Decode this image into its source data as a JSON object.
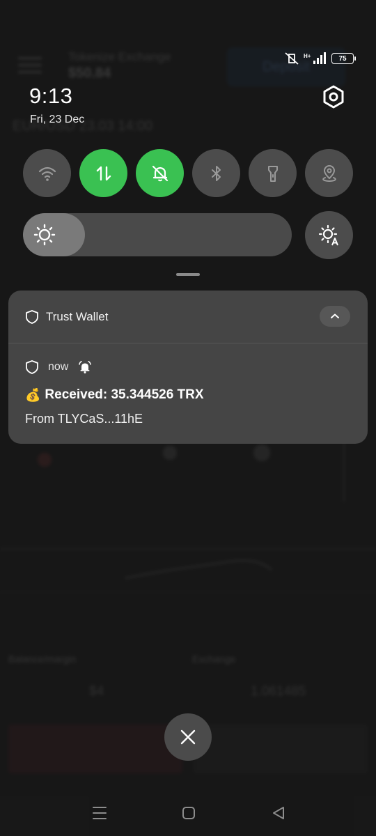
{
  "background_app": {
    "name": "Tokenize Exchange",
    "balance": "$50.84",
    "deposit_label": "Deposit",
    "pair": "EUR/USD 23.03 14:00",
    "label_a": "Balance/margin",
    "label_b": "Exchange",
    "row_left": "$4",
    "row_right": "1.061485"
  },
  "status_bar": {
    "battery": "75",
    "network": "H+"
  },
  "header": {
    "time": "9:13",
    "date": "Fri, 23 Dec"
  },
  "quick_settings": {
    "tiles": [
      {
        "name": "wifi",
        "icon": "wifi-icon",
        "active": false
      },
      {
        "name": "mobile-data",
        "icon": "mobile-data-icon",
        "active": true
      },
      {
        "name": "do-not-disturb",
        "icon": "bell-off-icon",
        "active": true
      },
      {
        "name": "bluetooth",
        "icon": "bluetooth-icon",
        "active": false
      },
      {
        "name": "flashlight",
        "icon": "flashlight-icon",
        "active": false
      },
      {
        "name": "location",
        "icon": "location-icon",
        "active": false
      }
    ],
    "brightness_level": 0.23,
    "auto_brightness_icon": "auto-brightness-icon"
  },
  "notification": {
    "app_name": "Trust Wallet",
    "time_label": "now",
    "title_emoji": "💰",
    "title": "Received: 35.344526 TRX",
    "body": "From TLYCaS...11hE"
  },
  "colors": {
    "tile_active": "#3ac152",
    "tile_inactive": "#4c4c4c",
    "notification_bg": "#454545"
  }
}
